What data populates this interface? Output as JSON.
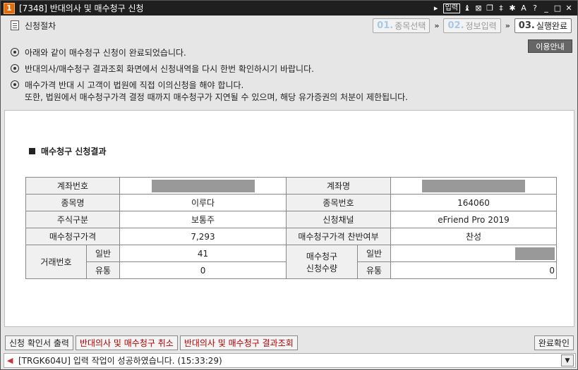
{
  "window": {
    "badge": "1",
    "title": "[7348] 반대의사 및 매수청구 신청",
    "controls": [
      "▸",
      "입력",
      "♝",
      "⊠",
      "❐",
      "‡",
      "✱",
      "A",
      "?",
      "_",
      "□",
      "✕"
    ]
  },
  "steps_header": {
    "label": "신청절차",
    "steps": [
      {
        "num": "01.",
        "label": "종목선택"
      },
      {
        "num": "02.",
        "label": "정보입력"
      },
      {
        "num": "03.",
        "label": "실행완료"
      }
    ],
    "chevron": "»"
  },
  "help_button": "이용안내",
  "notes": [
    "아래와 같이 매수청구 신청이 완료되었습니다.",
    "반대의사/매수청구 결과조회 화면에서 신청내역을 다시 한번 확인하시기 바랍니다.",
    "매수가격 반대 시 고객이 법원에 직접 이의신청을 해야 합니다."
  ],
  "note_sub": "또한, 법원에서 매수청구가격 결정 때까지 매수청구가 지연될 수 있으며, 해당 유가증권의 처분이 제한됩니다.",
  "section_title": "매수청구 신청결과",
  "table": {
    "account_no_label": "계좌번호",
    "account_name_label": "계좌명",
    "stock_name_label": "종목명",
    "stock_name": "이루다",
    "stock_code_label": "종목번호",
    "stock_code": "164060",
    "stock_type_label": "주식구분",
    "stock_type": "보통주",
    "channel_label": "신청채널",
    "channel": "eFriend Pro 2019",
    "price_label": "매수청구가격",
    "price": "7,293",
    "approval_label": "매수청구가격 찬반여부",
    "approval": "찬성",
    "trade_no_label": "거래번호",
    "general_label": "일반",
    "distribution_label": "유통",
    "trade_general": "41",
    "trade_distribution": "0",
    "qty_label_1": "매수청구",
    "qty_label_2": "신청수량",
    "qty_distribution": "0"
  },
  "buttons": {
    "print": "신청 확인서 출력",
    "cancel": "반대의사 및 매수청구 취소",
    "inquiry": "반대의사 및 매수청구 결과조회",
    "confirm": "완료확인"
  },
  "status": {
    "message": "[TRGK604U] 입력 작업이 성공하였습니다. (15:33:29)",
    "dropdown": "▼"
  }
}
